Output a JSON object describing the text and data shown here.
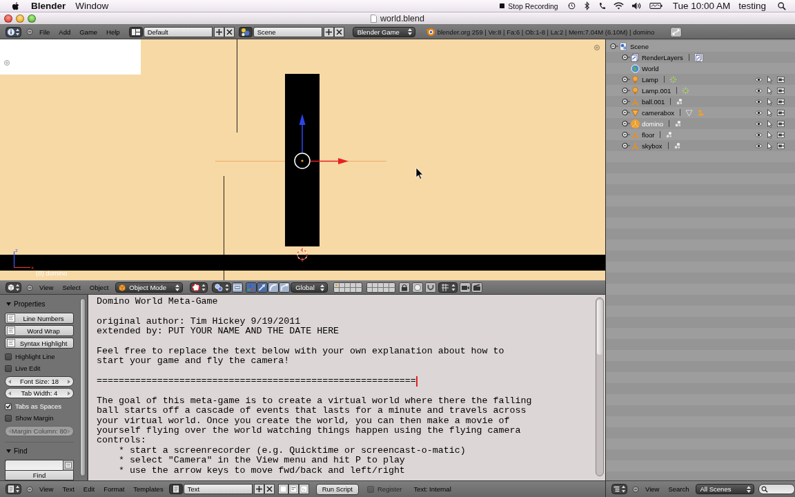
{
  "menu_bar": {
    "app_name": "Blender",
    "menus": [
      "Window"
    ],
    "recording_label": "Stop Recording",
    "clock": "Tue 10:00 AM",
    "user": "testing"
  },
  "window": {
    "title": "world.blend"
  },
  "info_header": {
    "menus": [
      "File",
      "Add",
      "Game",
      "Help"
    ],
    "screen_layout": "Default",
    "scene": "Scene",
    "render_engine": "Blender Game",
    "stats": "blender.org 259 | Ve:8 | Fa:6 | Ob:1-8 | La:2 | Mem:7.04M (6.10M) | domino"
  },
  "viewport": {
    "axis_labels": [
      "z",
      "x"
    ],
    "object_label": "(0) domino"
  },
  "view3d_header": {
    "menus": [
      "View",
      "Select",
      "Object"
    ],
    "mode": "Object Mode",
    "manipulators": [
      {
        "kind": "axes",
        "on": true
      },
      {
        "kind": "move",
        "on": true
      },
      {
        "kind": "rotate",
        "on": false
      },
      {
        "kind": "scale",
        "on": false
      }
    ],
    "orientation": "Global"
  },
  "text_sidebar": {
    "panels": [
      {
        "title": "Properties",
        "expanded": true,
        "items": [
          {
            "kind": "toggle",
            "label": "Line Numbers",
            "on": false
          },
          {
            "kind": "toggle",
            "label": "Word Wrap",
            "on": false
          },
          {
            "kind": "toggle",
            "label": "Syntax Highlight",
            "on": false
          },
          {
            "kind": "checkbox",
            "label": "Highlight Line",
            "checked": false
          },
          {
            "kind": "checkbox",
            "label": "Live Edit",
            "checked": false
          },
          {
            "kind": "number",
            "label": "Font Size: 18",
            "disabled": false
          },
          {
            "kind": "number",
            "label": "Tab Width: 4",
            "disabled": false
          },
          {
            "kind": "checkbox",
            "label": "Tabs as Spaces",
            "checked": true
          },
          {
            "kind": "checkbox",
            "label": "Show Margin",
            "checked": false
          },
          {
            "kind": "number",
            "label": "Margin Column: 80",
            "disabled": true
          }
        ]
      },
      {
        "title": "Find",
        "expanded": true,
        "items": [
          {
            "kind": "input"
          },
          {
            "kind": "button",
            "label": "Find"
          }
        ]
      }
    ]
  },
  "text_editor": {
    "paragraphs": [
      {
        "lines": [
          "Domino World Meta-Game"
        ],
        "cursor": false
      },
      {
        "lines": [
          "original author: Tim Hickey 9/19/2011",
          "extended by: PUT YOUR NAME AND THE DATE HERE"
        ],
        "cursor": false
      },
      {
        "lines": [
          "Feel free to replace the text below with your own explanation about how to",
          "start your game and fly the camera!"
        ],
        "cursor": false
      },
      {
        "lines": [
          "=========================================================="
        ],
        "cursor": true
      },
      {
        "lines": [
          "The goal of this meta-game is to create a virtual world where there the falling",
          "ball starts off a cascade of events that lasts for a minute and travels across",
          "your virtual world. Once you create the world, you can then make a movie of",
          "yourself flying over the world watching things happen using the flying camera",
          "controls:",
          "    * start a screenrecorder (e.g. Quicktime or screencast-o-matic)",
          "    * select \"Camera\" in the View menu and hit P to play",
          "    * use the arrow keys to move fwd/back and left/right"
        ],
        "cursor": false
      }
    ]
  },
  "text_header": {
    "menus": [
      "View",
      "Text",
      "Edit",
      "Format",
      "Templates"
    ],
    "text_name": "Text",
    "run_script": "Run Script",
    "register": {
      "label": "Register",
      "checked": false,
      "disabled": true
    },
    "source": "Text: Internal"
  },
  "outliner": {
    "tree": [
      {
        "label": "Scene",
        "kind": "scene",
        "expanded": true,
        "selected": false,
        "children": [
          {
            "label": "RenderLayers",
            "kind": "render-layers",
            "expanded": false,
            "selected": false
          },
          {
            "label": "World",
            "kind": "world",
            "selected": false
          },
          {
            "label": "Lamp",
            "kind": "lamp",
            "expanded": false,
            "selected": false
          },
          {
            "label": "Lamp.001",
            "kind": "lamp",
            "expanded": false,
            "selected": false
          },
          {
            "label": "ball.001",
            "kind": "mesh",
            "expanded": false,
            "selected": false
          },
          {
            "label": "camerabox",
            "kind": "camera",
            "expanded": false,
            "selected": false
          },
          {
            "label": "domino",
            "kind": "mesh",
            "expanded": false,
            "selected": true
          },
          {
            "label": "floor",
            "kind": "mesh",
            "expanded": false,
            "selected": false
          },
          {
            "label": "skybox",
            "kind": "mesh",
            "expanded": false,
            "selected": false
          }
        ]
      }
    ]
  },
  "outliner_header": {
    "menus": [
      "View",
      "Search"
    ],
    "display_mode": "All Scenes"
  }
}
